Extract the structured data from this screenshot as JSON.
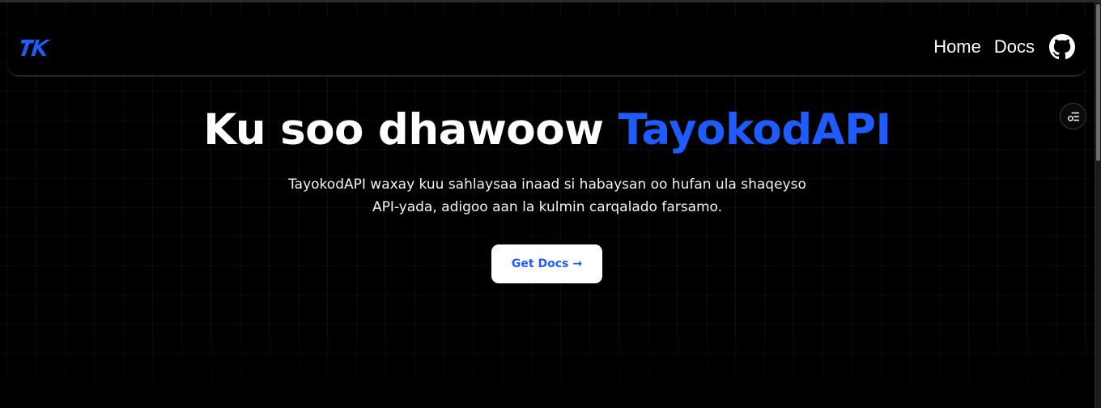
{
  "nav": {
    "logo_icon": "tk-logo-icon",
    "links": [
      "Home",
      "Docs"
    ],
    "github_icon": "github-icon"
  },
  "settings": {
    "icon": "settings-toggle-icon"
  },
  "hero": {
    "title_prefix": "Ku soo dhawoow ",
    "title_accent": "TayokodAPI",
    "description": "TayokodAPI waxay kuu sahlaysaa inaad si habaysan oo hufan ula shaqeyso API-yada, adigoo aan la kulmin carqalado farsamo.",
    "cta_label": "Get Docs",
    "cta_arrow": "→"
  },
  "colors": {
    "background": "#000000",
    "accent": "#1f5cff",
    "text": "#ffffff"
  }
}
